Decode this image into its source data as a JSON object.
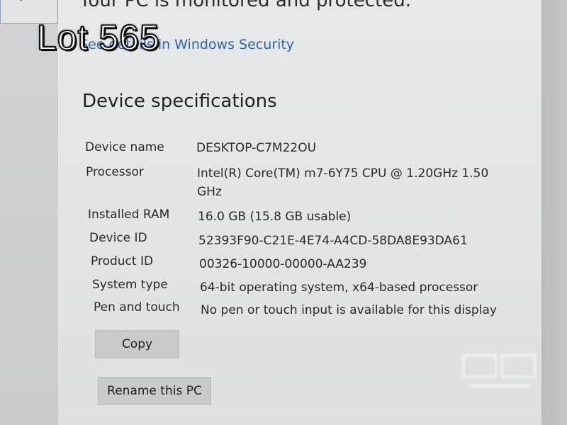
{
  "header": {
    "protection_status": "Your PC is monitored and protected.",
    "security_link": "See details in Windows Security"
  },
  "overlay": {
    "lot_label": "Lot 565"
  },
  "device_specifications": {
    "title": "Device specifications",
    "rows": [
      {
        "label": "Device name",
        "value": "DESKTOP-C7M22OU"
      },
      {
        "label": "Processor",
        "value": "Intel(R) Core(TM) m7-6Y75 CPU @ 1.20GHz   1.50",
        "value_cont": "GHz"
      },
      {
        "label": "Installed RAM",
        "value": "16.0 GB (15.8 GB usable)"
      },
      {
        "label": "Device ID",
        "value": "52393F90-C21E-4E74-A4CD-58DA8E93DA61"
      },
      {
        "label": "Product ID",
        "value": "00326-10000-00000-AA239"
      },
      {
        "label": "System type",
        "value": "64-bit operating system, x64-based processor"
      },
      {
        "label": "Pen and touch",
        "value": "No pen or touch input is available for this display"
      }
    ]
  },
  "buttons": {
    "copy": "Copy",
    "rename": "Rename this PC"
  },
  "icons": {
    "search": "search-icon",
    "watermark": "watermark-logo"
  },
  "colors": {
    "link": "#2f63b0",
    "button_bg": "#c9cacc",
    "text": "#2a2a2a"
  }
}
